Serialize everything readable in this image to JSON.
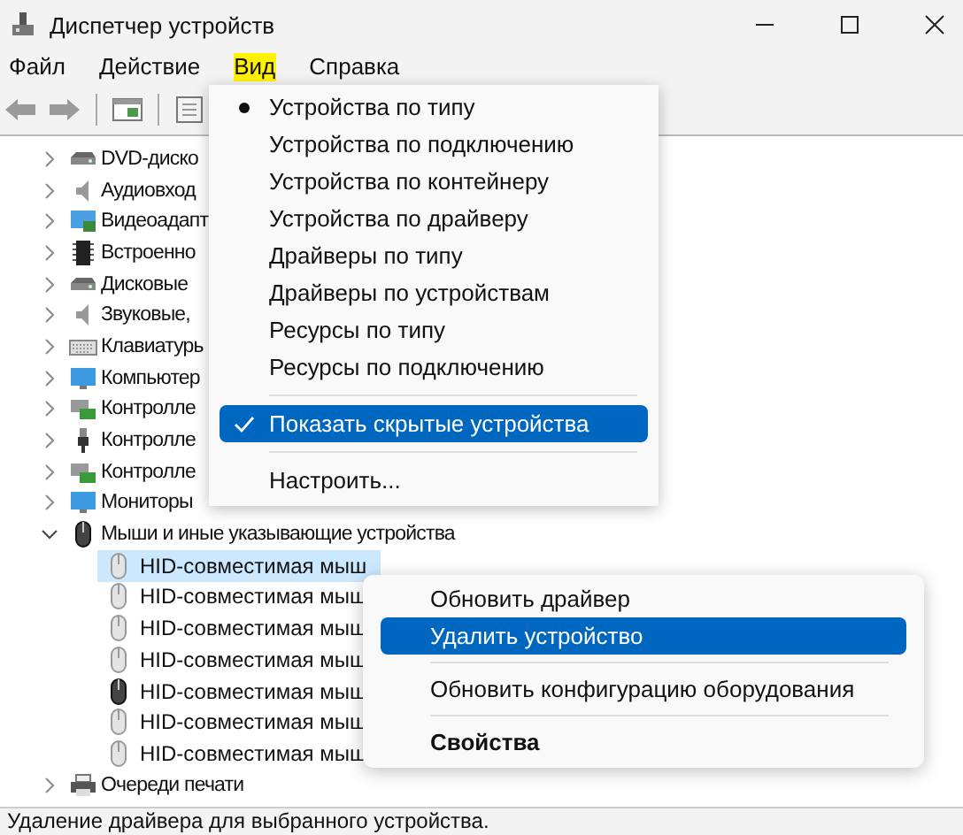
{
  "window": {
    "title": "Диспетчер устройств"
  },
  "menu_bar": [
    {
      "label": "Файл",
      "selected": false
    },
    {
      "label": "Действие",
      "selected": false
    },
    {
      "label": "Вид",
      "selected": true
    },
    {
      "label": "Справка",
      "selected": false
    }
  ],
  "tree": [
    {
      "label": "DVD-диско",
      "expanded": false
    },
    {
      "label": "Аудиовход",
      "expanded": false
    },
    {
      "label": "Видеоадапт",
      "expanded": false
    },
    {
      "label": "Встроенно",
      "expanded": false
    },
    {
      "label": "Дисковые",
      "expanded": false
    },
    {
      "label": "Звуковые,",
      "expanded": false
    },
    {
      "label": "Клавиатурь",
      "expanded": false
    },
    {
      "label": "Компьютер",
      "expanded": false
    },
    {
      "label": "Контролле",
      "expanded": false
    },
    {
      "label": "Контролле",
      "expanded": false
    },
    {
      "label": "Контролле",
      "expanded": false
    },
    {
      "label": "Мониторы",
      "expanded": false
    },
    {
      "label": "Мыши и иные указывающие устройства",
      "expanded": true,
      "children": [
        {
          "label": "HID-совместимая мыш",
          "selected": true,
          "hidden": true
        },
        {
          "label": "HID-совместимая мыш",
          "selected": false,
          "hidden": true
        },
        {
          "label": "HID-совместимая мыш",
          "selected": false,
          "hidden": true
        },
        {
          "label": "HID-совместимая мыш",
          "selected": false,
          "hidden": true
        },
        {
          "label": "HID-совместимая мыш",
          "selected": false,
          "hidden": false
        },
        {
          "label": "HID-совместимая мыш",
          "selected": false,
          "hidden": true
        },
        {
          "label": "HID-совместимая мыш",
          "selected": false,
          "hidden": true
        }
      ]
    },
    {
      "label": "Очереди печати",
      "expanded": false
    }
  ],
  "view_menu": [
    {
      "kind": "radio",
      "label": "Устройства по типу",
      "selected": true,
      "highlighted": false
    },
    {
      "kind": "radio",
      "label": "Устройства по подключению",
      "selected": false,
      "highlighted": false
    },
    {
      "kind": "radio",
      "label": "Устройства по контейнеру",
      "selected": false,
      "highlighted": false
    },
    {
      "kind": "radio",
      "label": "Устройства по драйверу",
      "selected": false,
      "highlighted": false
    },
    {
      "kind": "radio",
      "label": "Драйверы по типу",
      "selected": false,
      "highlighted": false
    },
    {
      "kind": "radio",
      "label": "Драйверы по устройствам",
      "selected": false,
      "highlighted": false
    },
    {
      "kind": "radio",
      "label": "Ресурсы по типу",
      "selected": false,
      "highlighted": false
    },
    {
      "kind": "radio",
      "label": "Ресурсы по подключению",
      "selected": false,
      "highlighted": false
    },
    {
      "kind": "separator"
    },
    {
      "kind": "check",
      "label": "Показать скрытые устройства",
      "checked": true,
      "highlighted": true
    },
    {
      "kind": "separator"
    },
    {
      "kind": "command",
      "label": "Настроить...",
      "highlighted": false
    }
  ],
  "context_menu": [
    {
      "kind": "command",
      "label": "Обновить драйвер",
      "highlighted": false,
      "default": false
    },
    {
      "kind": "command",
      "label": "Удалить устройство",
      "highlighted": true,
      "default": false
    },
    {
      "kind": "separator"
    },
    {
      "kind": "command",
      "label": "Обновить конфигурацию оборудования",
      "highlighted": false,
      "default": false
    },
    {
      "kind": "separator"
    },
    {
      "kind": "command",
      "label": "Свойства",
      "highlighted": false,
      "default": true
    }
  ],
  "status_bar": "Удаление драйвера для выбранного устройства."
}
